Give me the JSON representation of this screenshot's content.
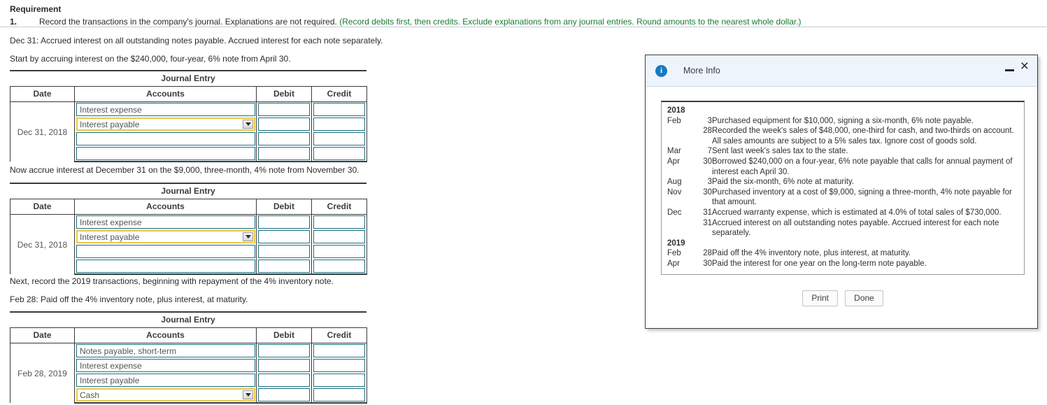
{
  "requirement": {
    "heading": "Requirement",
    "number": "1.",
    "text": "Record the transactions in the company's journal. Explanations are not required. ",
    "hint": "(Record debits first, then credits. Exclude explanations from any journal entries. Round amounts to the nearest whole dollar.)"
  },
  "prompts": {
    "p1": "Dec 31: Accrued interest on all outstanding notes payable. Accrued interest for each note separately.",
    "p2": "Start by accruing interest on the $240,000, four-year, 6% note from April 30.",
    "p3": "Now accrue interest at December 31 on the $9,000, three-month, 4% note from November 30.",
    "p4": "Next, record the 2019 transactions, beginning with repayment of the 4% inventory note.",
    "p5": "Feb 28: Paid off the 4% inventory note, plus interest, at maturity."
  },
  "journal": {
    "title": "Journal Entry",
    "headers": {
      "date": "Date",
      "accounts": "Accounts",
      "debit": "Debit",
      "credit": "Credit"
    },
    "entries": [
      {
        "date": "Dec 31, 2018",
        "rows": [
          {
            "account": "Interest expense",
            "dropdown": false,
            "debit": "",
            "credit": ""
          },
          {
            "account": "Interest payable",
            "dropdown": true,
            "debit": "",
            "credit": ""
          },
          {
            "account": "",
            "dropdown": false,
            "debit": "",
            "credit": ""
          },
          {
            "account": "",
            "dropdown": false,
            "debit": "",
            "credit": ""
          }
        ]
      },
      {
        "date": "Dec 31, 2018",
        "rows": [
          {
            "account": "Interest expense",
            "dropdown": false,
            "debit": "",
            "credit": ""
          },
          {
            "account": "Interest payable",
            "dropdown": true,
            "debit": "",
            "credit": ""
          },
          {
            "account": "",
            "dropdown": false,
            "debit": "",
            "credit": ""
          },
          {
            "account": "",
            "dropdown": false,
            "debit": "",
            "credit": ""
          }
        ]
      },
      {
        "date": "Feb 28, 2019",
        "rows": [
          {
            "account": "Notes payable, short-term",
            "dropdown": false,
            "debit": "",
            "credit": ""
          },
          {
            "account": "Interest expense",
            "dropdown": false,
            "debit": "",
            "credit": ""
          },
          {
            "account": "Interest payable",
            "dropdown": false,
            "debit": "",
            "credit": ""
          },
          {
            "account": "Cash",
            "dropdown": true,
            "debit": "",
            "credit": ""
          }
        ]
      }
    ]
  },
  "dialog": {
    "title": "More Info",
    "icon": "info-icon",
    "minimize_label": "–",
    "close_label": "×",
    "ledger": [
      {
        "type": "year",
        "year": "2018"
      },
      {
        "type": "entry",
        "month": "Feb",
        "day": "3",
        "desc": "Purchased equipment for $10,000, signing a six-month, 6% note payable."
      },
      {
        "type": "entry",
        "month": "",
        "day": "28",
        "desc": "Recorded the week's sales of $48,000, one-third for cash, and two-thirds on account. All sales amounts are subject to a 5% sales tax. Ignore cost of goods sold."
      },
      {
        "type": "entry",
        "month": "Mar",
        "day": "7",
        "desc": "Sent last week's sales tax to the state."
      },
      {
        "type": "entry",
        "month": "Apr",
        "day": "30",
        "desc": "Borrowed $240,000 on a four-year, 6% note payable that calls for annual payment of interest each April 30."
      },
      {
        "type": "entry",
        "month": "Aug",
        "day": "3",
        "desc": "Paid the six-month, 6% note at maturity."
      },
      {
        "type": "entry",
        "month": "Nov",
        "day": "30",
        "desc": "Purchased inventory at a cost of $9,000, signing a three-month, 4% note payable for that amount."
      },
      {
        "type": "entry",
        "month": "Dec",
        "day": "31",
        "desc": "Accrued warranty expense, which is estimated at 4.0% of total sales of $730,000."
      },
      {
        "type": "entry",
        "month": "",
        "day": "31",
        "desc": "Accrued interest on all outstanding notes payable. Accrued interest for each note separately."
      },
      {
        "type": "year",
        "year": "2019"
      },
      {
        "type": "entry",
        "month": "Feb",
        "day": "28",
        "desc": "Paid off the 4% inventory note, plus interest, at maturity."
      },
      {
        "type": "entry",
        "month": "Apr",
        "day": "30",
        "desc": "Paid the interest for one year on the long-term note payable."
      }
    ],
    "buttons": {
      "print": "Print",
      "done": "Done"
    }
  },
  "colors": {
    "hint_green": "#1a7a32",
    "field_border_teal": "#1b6e80",
    "selected_border_gold": "#e8c84a",
    "dialog_header_blue": "#eef4fc",
    "info_icon_blue": "#1779c4"
  }
}
